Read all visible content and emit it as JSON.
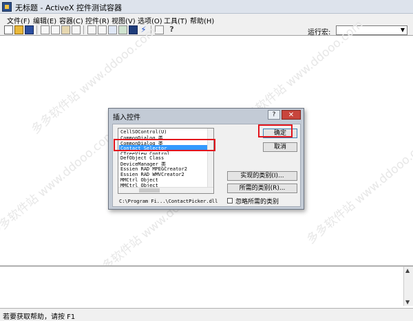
{
  "window": {
    "title": "无标题 - ActiveX 控件测试容器"
  },
  "menu": [
    "文件(F)",
    "编辑(E)",
    "容器(C)",
    "控件(R)",
    "视图(V)",
    "选项(O)",
    "工具(T)",
    "帮助(H)"
  ],
  "toolbar": {
    "icons": [
      "new-icon",
      "open-icon",
      "save-icon",
      "cut-icon",
      "copy-icon",
      "paste-icon",
      "delete-icon",
      "insert-control-icon",
      "properties-icon",
      "invoke-methods-icon",
      "ambient-icon",
      "view-icon",
      "events-icon",
      "design-mode-icon",
      "help-icon"
    ],
    "macro_label": "运行宏:",
    "macro_value": ""
  },
  "watermark": "多多软件站  www.ddooo.com",
  "status": "若要获取帮助，请按 F1",
  "dialog": {
    "title": "插入控件",
    "help_glyph": "?",
    "close_glyph": "✕",
    "controls": [
      "CellSOControl(U)",
      "CommonDialog 类",
      "Contact Selector",
      "CTreeView Control",
      "DefObject Class",
      "DeviceManager 类",
      "Essien RAD MPEGCreator2",
      "Essien RAD WMVCreator2",
      "MMCtrl Object",
      "MMCtrl Object"
    ],
    "selected": "Contact Selector",
    "path": "C:\\Program Fi...\\ContactPicker.dll",
    "ok_label": "确定",
    "cancel_label": "取消",
    "implemented_label": "实现的类别(I)...",
    "required_label": "所需的类别(R)...",
    "ignore_label": "忽略所需的类别"
  },
  "colors": {
    "highlight": "#3399ff",
    "annotation": "#e3141c",
    "close_button": "#c8453c"
  }
}
